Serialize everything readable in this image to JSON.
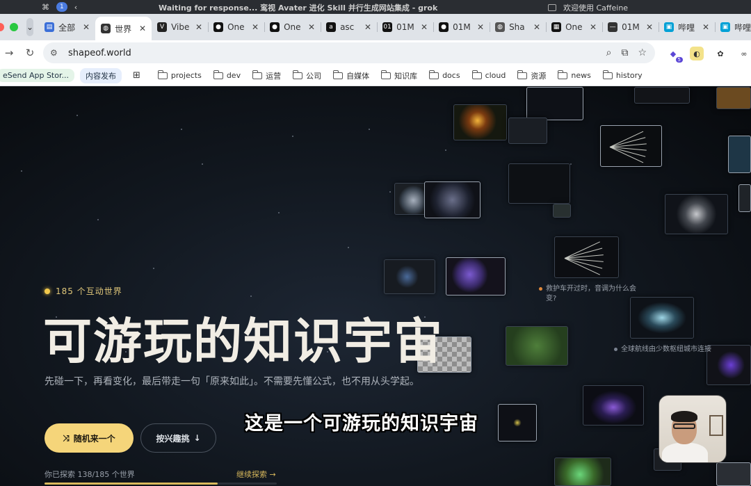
{
  "os_bar": {
    "notification_count": "1",
    "window_title": "Waiting for response...   鸾视 Avater 进化 Skill 并行生成网站集成 - grok",
    "right_text": "欢迎使用 Caffeine"
  },
  "tabs": [
    {
      "title": "全部",
      "icon": "doc-icon",
      "color": "#3b6fd8",
      "active": false
    },
    {
      "title": "世界",
      "icon": "globe-icon",
      "color": "#333333",
      "active": true
    },
    {
      "title": "Vibe",
      "icon": "v-logo-icon",
      "color": "#222222",
      "active": false
    },
    {
      "title": "One",
      "icon": "github-icon",
      "color": "#111111",
      "active": false
    },
    {
      "title": "One",
      "icon": "github-icon",
      "color": "#111111",
      "active": false
    },
    {
      "title": "asc",
      "icon": "asc-icon",
      "color": "#111111",
      "active": false
    },
    {
      "title": "01M",
      "icon": "01-logo-icon",
      "color": "#111111",
      "active": false
    },
    {
      "title": "01M",
      "icon": "github-icon",
      "color": "#111111",
      "active": false
    },
    {
      "title": "Sha",
      "icon": "globe-icon",
      "color": "#555555",
      "active": false
    },
    {
      "title": "One",
      "icon": "grid-logo-icon",
      "color": "#111111",
      "active": false
    },
    {
      "title": "01M",
      "icon": "dash-icon",
      "color": "#333333",
      "active": false
    },
    {
      "title": "哔哩",
      "icon": "bilibili-icon",
      "color": "#00a1d6",
      "active": false
    },
    {
      "title": "哔哩",
      "icon": "bilibili-icon",
      "color": "#00a1d6",
      "active": false
    }
  ],
  "address": {
    "url": "shapeof.world"
  },
  "bookmarks": {
    "pill1": "eSend App Stor...",
    "pill2": "内容发布",
    "folders": [
      "projects",
      "dev",
      "运营",
      "公司",
      "自媒体",
      "知识库",
      "docs",
      "cloud",
      "资源",
      "news",
      "history"
    ]
  },
  "hero": {
    "count_label": "185 个互动世界",
    "title": "可游玩的知识宇宙",
    "subtitle": "先碰一下，再看变化，最后带走一句「原来如此」。不需要先懂公式，也不用从头学起。",
    "primary_button": "随机来一个",
    "secondary_button": "按兴趣挑",
    "progress_text": "你已探索 138/185 个世界",
    "progress_done": 138,
    "progress_total": 185,
    "continue_link": "继续探索 →"
  },
  "floating_labels": [
    {
      "text": "救护车开过时，音调为什么会变?",
      "dot_color": "#e0883a"
    },
    {
      "text": "全球航线由少数枢纽城市连接",
      "dot_color": "#7a8290"
    }
  ],
  "video_caption": "这是一个可游玩的知识宇宙",
  "colors": {
    "accent": "#f5d57a",
    "page_bg": "#0b0e12"
  }
}
